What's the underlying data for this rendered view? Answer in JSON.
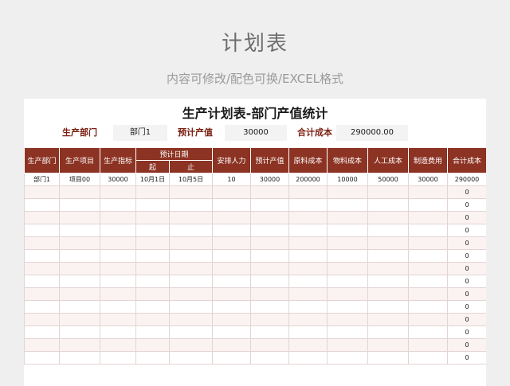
{
  "page": {
    "title": "计划表",
    "subtitle": "内容可修改/配色可换/EXCEL格式"
  },
  "sheet": {
    "title": "生产计划表-部门产值统计",
    "info": {
      "dept_label": "生产部门",
      "dept_value": "部门1",
      "plan_label": "预计产值",
      "plan_value": "30000",
      "total_label": "合计成本",
      "total_value": "290000.00"
    },
    "headers": {
      "dept": "生产部门",
      "project": "生产项目",
      "target": "生产指标",
      "plan_date": "预计日期",
      "date_start": "起",
      "date_end": "止",
      "manpower": "安排人力",
      "plan_output": "预计产值",
      "raw_cost": "原料成本",
      "material_cost": "物料成本",
      "labor_cost": "人工成本",
      "mfg_cost": "制造费用",
      "total_cost": "合计成本"
    },
    "rows": [
      [
        "部门1",
        "项目00",
        "30000",
        "10月1日",
        "10月5日",
        "10",
        "30000",
        "200000",
        "10000",
        "50000",
        "30000",
        "290000"
      ],
      [
        "",
        "",
        "",
        "",
        "",
        "",
        "",
        "",
        "",
        "",
        "",
        "0"
      ],
      [
        "",
        "",
        "",
        "",
        "",
        "",
        "",
        "",
        "",
        "",
        "",
        "0"
      ],
      [
        "",
        "",
        "",
        "",
        "",
        "",
        "",
        "",
        "",
        "",
        "",
        "0"
      ],
      [
        "",
        "",
        "",
        "",
        "",
        "",
        "",
        "",
        "",
        "",
        "",
        "0"
      ],
      [
        "",
        "",
        "",
        "",
        "",
        "",
        "",
        "",
        "",
        "",
        "",
        "0"
      ],
      [
        "",
        "",
        "",
        "",
        "",
        "",
        "",
        "",
        "",
        "",
        "",
        "0"
      ],
      [
        "",
        "",
        "",
        "",
        "",
        "",
        "",
        "",
        "",
        "",
        "",
        "0"
      ],
      [
        "",
        "",
        "",
        "",
        "",
        "",
        "",
        "",
        "",
        "",
        "",
        "0"
      ],
      [
        "",
        "",
        "",
        "",
        "",
        "",
        "",
        "",
        "",
        "",
        "",
        "0"
      ],
      [
        "",
        "",
        "",
        "",
        "",
        "",
        "",
        "",
        "",
        "",
        "",
        "0"
      ],
      [
        "",
        "",
        "",
        "",
        "",
        "",
        "",
        "",
        "",
        "",
        "",
        "0"
      ],
      [
        "",
        "",
        "",
        "",
        "",
        "",
        "",
        "",
        "",
        "",
        "",
        "0"
      ],
      [
        "",
        "",
        "",
        "",
        "",
        "",
        "",
        "",
        "",
        "",
        "",
        "0"
      ],
      [
        "",
        "",
        "",
        "",
        "",
        "",
        "",
        "",
        "",
        "",
        "",
        "0"
      ]
    ]
  }
}
